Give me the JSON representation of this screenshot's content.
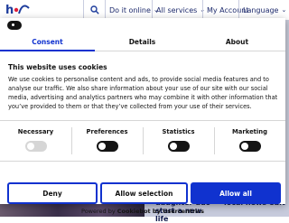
{
  "header": {
    "logo_text": "h∈f",
    "nav": [
      {
        "label": "Do it online"
      },
      {
        "label": "All services"
      },
      {
        "label": "My Account"
      },
      {
        "label": "Language"
      }
    ]
  },
  "background": {
    "news_1": "daughter duo start a new life",
    "news_2": "local news edit"
  },
  "cookie_dialog": {
    "tabs": [
      "Consent",
      "Details",
      "About"
    ],
    "active_tab": "Consent",
    "title": "This website uses cookies",
    "body": "We use cookies to personalise content and ads, to provide social media features and to analyse our traffic. We also share information about your use of our site with our social media, advertising and analytics partners who may combine it with other information that you’ve provided to them or that they’ve collected from your use of their services.",
    "settings": [
      {
        "label": "Necessary",
        "state": "on-disabled"
      },
      {
        "label": "Preferences",
        "state": "off"
      },
      {
        "label": "Statistics",
        "state": "off"
      },
      {
        "label": "Marketing",
        "state": "off"
      }
    ],
    "buttons": {
      "deny": "Deny",
      "allow_selection": "Allow selection",
      "allow_all": "Allow all"
    },
    "powered_by": "Powered by",
    "powered_by_brand": "Cookiebot by Usercentrics"
  },
  "colors": {
    "accent": "#1032cf",
    "text": "#141414",
    "header_text": "#1d2a6c",
    "logo_blue": "#1d3c9c",
    "logo_red": "#e0203a"
  }
}
